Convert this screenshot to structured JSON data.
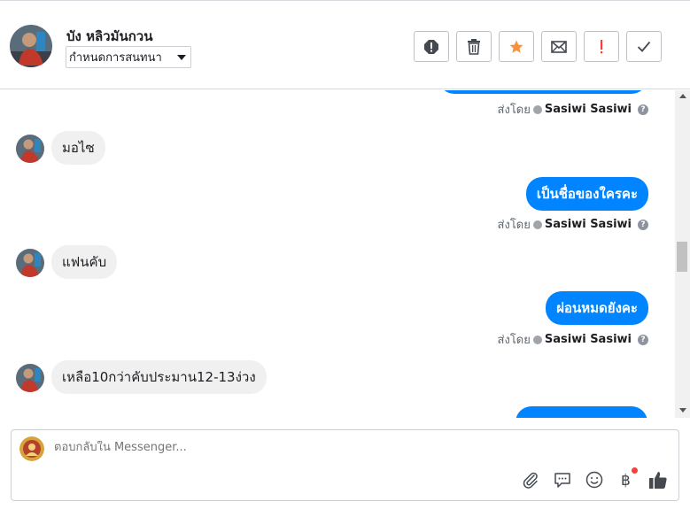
{
  "header": {
    "contact_name": "บัง หลิวมันกวน",
    "assign_label": "กำหนดการสนทนา",
    "actions": [
      {
        "name": "spam",
        "icon": "alert-circle-icon"
      },
      {
        "name": "delete",
        "icon": "trash-icon"
      },
      {
        "name": "star",
        "icon": "star-icon",
        "color": "#f7923b"
      },
      {
        "name": "mark-unread",
        "icon": "envelope-icon"
      },
      {
        "name": "follow-up",
        "icon": "exclamation-icon",
        "color": "#fa3e3e"
      },
      {
        "name": "done",
        "icon": "check-icon"
      }
    ]
  },
  "messages": {
    "sent_by_label": "ส่งโดย",
    "sender": "Sasiwi Sasiwi",
    "items": [
      {
        "direction": "in",
        "text": "มอไซ"
      },
      {
        "direction": "out",
        "text": "เป็นชื่อของใครคะ"
      },
      {
        "direction": "in",
        "text": "แฟนคับ"
      },
      {
        "direction": "out",
        "text": "ผ่อนหมดยังคะ"
      },
      {
        "direction": "in",
        "text": "เหลือ10กว่าคับประมาน12-13ง่วง"
      }
    ]
  },
  "composer": {
    "placeholder": "ตอบกลับใน Messenger...",
    "tools": [
      "attach-icon",
      "saved-reply-icon",
      "emoji-icon",
      "baht-payment-icon",
      "thumbs-up-icon"
    ]
  },
  "colors": {
    "accent": "#0084ff",
    "incoming_bubble": "#f0f0f0",
    "star": "#f7923b",
    "alert": "#fa3e3e"
  }
}
